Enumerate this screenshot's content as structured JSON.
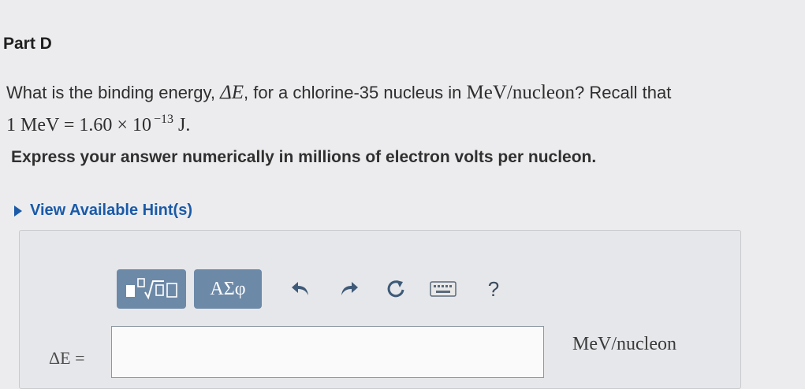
{
  "part": {
    "title": "Part D"
  },
  "question": {
    "text_1": "What is the binding energy, ",
    "delta_e": "ΔE",
    "text_2": ", for a chlorine-35 nucleus in ",
    "unit": "MeV/nucleon",
    "text_3": "? Recall that",
    "expr_lhs": "1 MeV = 1.60 × 10",
    "expr_exp": "−13",
    "expr_unit": "J",
    "period": "."
  },
  "instruction": "Express your answer numerically in millions of electron volts per nucleon.",
  "hint": {
    "label": "View Available Hint(s)"
  },
  "toolbar": {
    "greek_label": "ΑΣφ",
    "help_label": "?",
    "icons": [
      "templates-icon",
      "greek-symbols-icon",
      "undo-icon",
      "redo-icon",
      "reset-icon",
      "keyboard-icon",
      "help-icon"
    ],
    "button_color": "#6d89a8"
  },
  "answer": {
    "variable_label": "ΔE =",
    "value": "",
    "placeholder": "",
    "unit_label": "MeV/nucleon"
  },
  "colors": {
    "hint_link": "#1a5aa8",
    "background": "#ececee"
  }
}
